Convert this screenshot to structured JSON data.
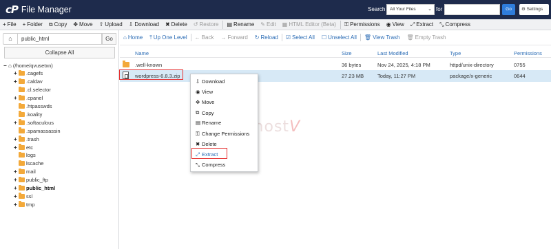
{
  "header": {
    "logo_mark": "cP",
    "title": "File Manager",
    "search_label": "Search",
    "search_scope": "All Your Files",
    "for_label": "for",
    "go_label": "Go",
    "settings_label": "Settings"
  },
  "toolbar": [
    {
      "icon": "+",
      "label": "File",
      "disabled": false
    },
    {
      "icon": "+",
      "label": "Folder",
      "disabled": false
    },
    {
      "icon": "⧉",
      "label": "Copy",
      "disabled": false
    },
    {
      "icon": "✥",
      "label": "Move",
      "disabled": false
    },
    {
      "icon": "⇧",
      "label": "Upload",
      "disabled": false
    },
    {
      "icon": "⇩",
      "label": "Download",
      "disabled": false
    },
    {
      "icon": "✖",
      "label": "Delete",
      "disabled": false
    },
    {
      "icon": "↺",
      "label": "Restore",
      "disabled": true
    },
    {
      "icon": "▤",
      "label": "Rename",
      "disabled": false
    },
    {
      "icon": "✎",
      "label": "Edit",
      "disabled": true
    },
    {
      "icon": "▦",
      "label": "HTML Editor (Beta)",
      "disabled": true
    },
    {
      "icon": "⚿",
      "label": "Permissions",
      "disabled": false
    },
    {
      "icon": "◉",
      "label": "View",
      "disabled": false
    },
    {
      "icon": "⤢",
      "label": "Extract",
      "disabled": false
    },
    {
      "icon": "⤡",
      "label": "Compress",
      "disabled": false
    }
  ],
  "left": {
    "path_value": "public_html",
    "go_label": "Go",
    "collapse_label": "Collapse All",
    "root_label": "(/home/qvusetxn)",
    "tree": [
      {
        "label": ".cagefs",
        "expandable": true,
        "bold": false
      },
      {
        "label": ".caldav",
        "expandable": true,
        "bold": false
      },
      {
        "label": ".cl.selector",
        "expandable": false,
        "bold": false
      },
      {
        "label": ".cpanel",
        "expandable": true,
        "bold": false
      },
      {
        "label": ".htpasswds",
        "expandable": false,
        "bold": false
      },
      {
        "label": ".koality",
        "expandable": false,
        "bold": false
      },
      {
        "label": ".softaculous",
        "expandable": true,
        "bold": false
      },
      {
        "label": ".spamassassin",
        "expandable": false,
        "bold": false
      },
      {
        "label": ".trash",
        "expandable": true,
        "bold": false
      },
      {
        "label": "etc",
        "expandable": true,
        "bold": false
      },
      {
        "label": "logs",
        "expandable": false,
        "bold": false
      },
      {
        "label": "lscache",
        "expandable": false,
        "bold": false
      },
      {
        "label": "mail",
        "expandable": true,
        "bold": false
      },
      {
        "label": "public_ftp",
        "expandable": true,
        "bold": false
      },
      {
        "label": "public_html",
        "expandable": true,
        "bold": true
      },
      {
        "label": "ssl",
        "expandable": true,
        "bold": false
      },
      {
        "label": "tmp",
        "expandable": true,
        "bold": false
      }
    ]
  },
  "right": {
    "toolbar": [
      {
        "icon": "⌂",
        "label": "Home",
        "disabled": false
      },
      {
        "icon": "⤒",
        "label": "Up One Level",
        "disabled": false
      },
      {
        "icon": "←",
        "label": "Back",
        "disabled": true
      },
      {
        "icon": "→",
        "label": "Forward",
        "disabled": true
      },
      {
        "icon": "↻",
        "label": "Reload",
        "disabled": false
      },
      {
        "icon": "☑",
        "label": "Select All",
        "disabled": false
      },
      {
        "icon": "☐",
        "label": "Unselect All",
        "disabled": false
      },
      {
        "icon": "🗑",
        "label": "View Trash",
        "disabled": false
      },
      {
        "icon": "🗑",
        "label": "Empty Trash",
        "disabled": true
      }
    ],
    "columns": {
      "name": "Name",
      "size": "Size",
      "modified": "Last Modified",
      "type": "Type",
      "permissions": "Permissions"
    },
    "rows": [
      {
        "name": ".well-known",
        "size": "36 bytes",
        "modified": "Nov 24, 2025, 4:18 PM",
        "type": "httpd/unix-directory",
        "permissions": "0755"
      },
      {
        "name": "wordpress-6.8.3.zip",
        "size": "27.23 MB",
        "modified": "Today, 11:27 PM",
        "type": "package/x-generic",
        "permissions": "0644"
      }
    ]
  },
  "context_menu": [
    {
      "icon": "⇩",
      "label": "Download"
    },
    {
      "icon": "◉",
      "label": "View"
    },
    {
      "icon": "✥",
      "label": "Move"
    },
    {
      "icon": "⧉",
      "label": "Copy"
    },
    {
      "icon": "▤",
      "label": "Rename"
    },
    {
      "icon": "⚿",
      "label": "Change Permissions"
    },
    {
      "icon": "✖",
      "label": "Delete"
    },
    {
      "icon": "⤢",
      "label": "Extract"
    },
    {
      "icon": "⤡",
      "label": "Compress"
    }
  ],
  "watermark": {
    "text": "vinahost",
    "mark": "V"
  }
}
